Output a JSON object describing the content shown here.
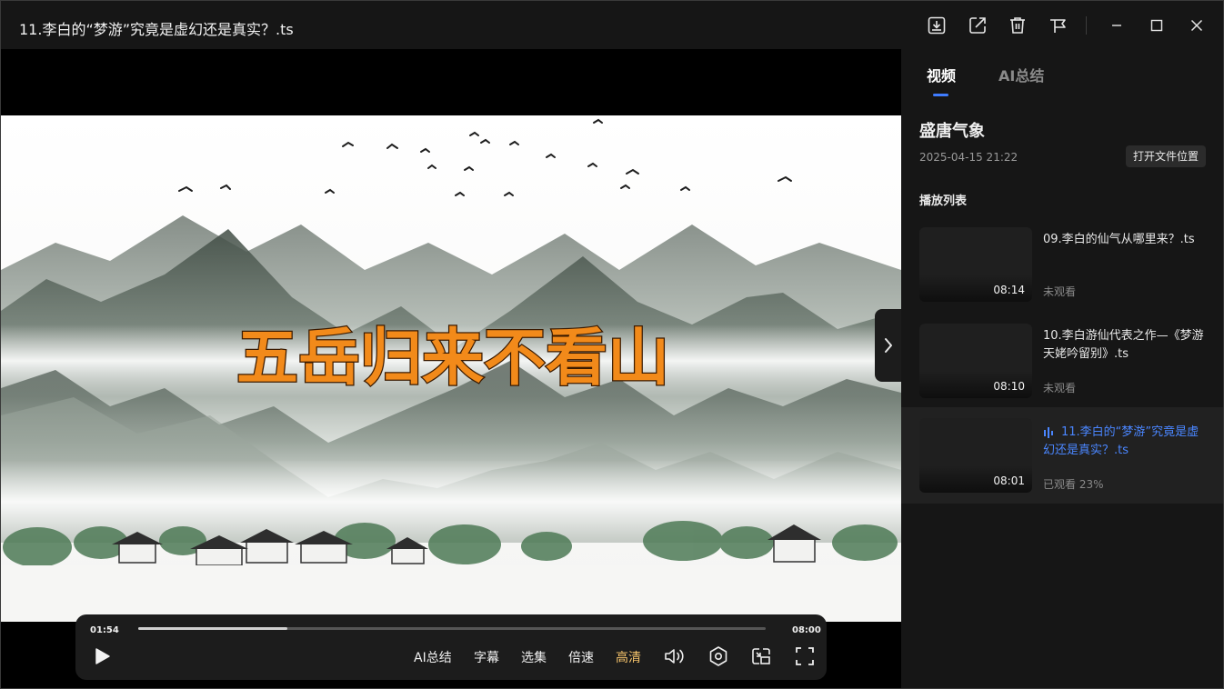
{
  "window": {
    "title": "11.李白的“梦游”究竟是虚幻还是真实？.ts",
    "buttons": [
      "download-icon",
      "open-external-icon",
      "delete-icon",
      "pin-icon",
      "minimize-icon",
      "maximize-icon",
      "close-icon"
    ]
  },
  "video": {
    "caption": "五岳归来不看山",
    "caption_color": "#f28a1a",
    "caption_stroke": "#3a1a00"
  },
  "controls": {
    "current_time": "01:54",
    "total_time": "08:00",
    "progress_fraction": 0.2375,
    "ai_summary_label": "AI总结",
    "subtitle_label": "字幕",
    "episodes_label": "选集",
    "speed_label": "倍速",
    "quality_label": "高清",
    "quality_color": "#f5c36b"
  },
  "side": {
    "tab_video": "视频",
    "tab_ai": "AI总结",
    "folder_name": "盛唐气象",
    "folder_date": "2025-04-15 21:22",
    "open_location": "打开文件位置",
    "playlist_title": "播放列表",
    "accent": "#3f7cff",
    "items": [
      {
        "name": "09.李白的仙气从哪里来？.ts",
        "duration": "08:14",
        "status": "未观看",
        "active": false
      },
      {
        "name": "10.李白游仙代表之作—《梦游天姥吟留别》.ts",
        "duration": "08:10",
        "status": "未观看",
        "active": false
      },
      {
        "name": "11.李白的“梦游”究竟是虚幻还是真实？.ts",
        "duration": "08:01",
        "status": "已观看 23%",
        "active": true
      }
    ]
  }
}
